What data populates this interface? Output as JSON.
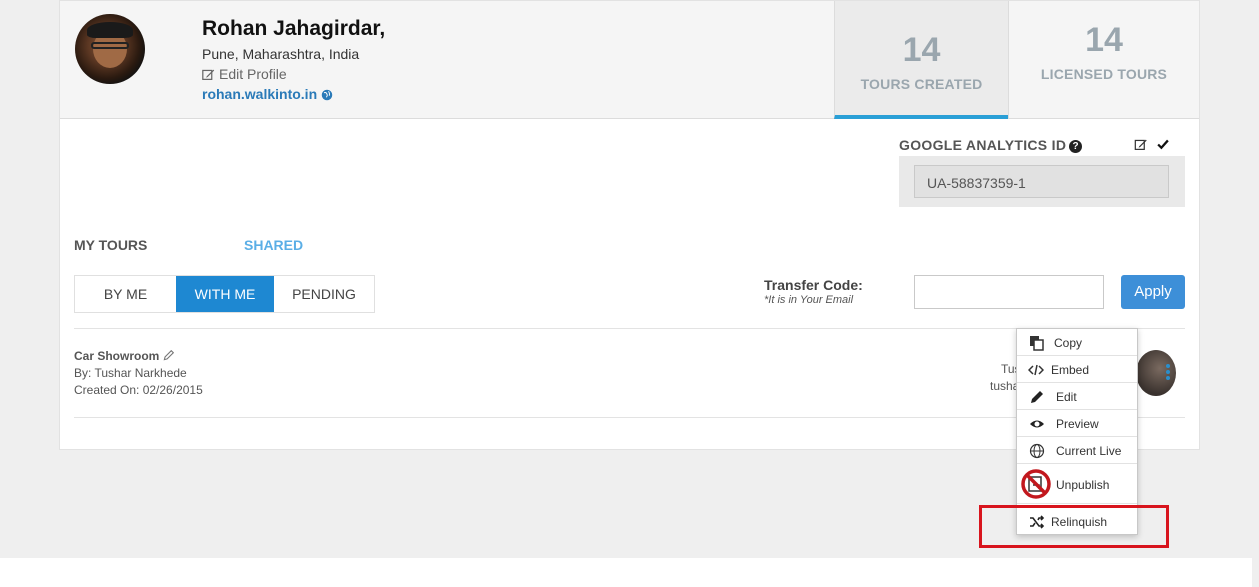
{
  "profile": {
    "name": "Rohan Jahagirdar,",
    "location": "Pune, Maharashtra, India",
    "edit_label": "Edit Profile",
    "website": "rohan.walkinto.in"
  },
  "stats": {
    "tours_created": {
      "value": "14",
      "label": "TOURS CREATED"
    },
    "licensed_tours": {
      "value": "14",
      "label": "LICENSED TOURS"
    }
  },
  "analytics": {
    "label": "GOOGLE ANALYTICS ID",
    "help": "?",
    "value": "UA-58837359-1"
  },
  "tabs": {
    "my_tours": "MY TOURS",
    "shared": "SHARED"
  },
  "filter": {
    "by_me": "BY ME",
    "with_me": "WITH ME",
    "pending": "PENDING",
    "selected": "WITH ME"
  },
  "transfer": {
    "label": "Transfer Code:",
    "note": "*It is in Your Email",
    "input_value": "",
    "apply_label": "Apply"
  },
  "tour": {
    "title": "Car Showroom",
    "by": "By: Tushar Narkhede",
    "created": "Created On: 02/26/2015",
    "owner_line1": "Tus",
    "owner_line2": "tusha"
  },
  "context_menu": {
    "items": [
      {
        "label": "Copy",
        "icon": "copy-icon"
      },
      {
        "label": "Embed",
        "icon": "code-icon"
      },
      {
        "label": "Edit",
        "icon": "pencil-icon"
      },
      {
        "label": "Preview",
        "icon": "eye-icon"
      },
      {
        "label": "Current Live",
        "icon": "globe-icon"
      },
      {
        "label": "Unpublish",
        "icon": "unpublish-icon"
      },
      {
        "label": "Relinquish",
        "icon": "shuffle-icon"
      }
    ]
  },
  "colors": {
    "accent_blue": "#1e88d2",
    "apply_blue": "#3d8fd8",
    "highlight_red": "#d8141d",
    "stat_gray": "#9aa6ae"
  }
}
